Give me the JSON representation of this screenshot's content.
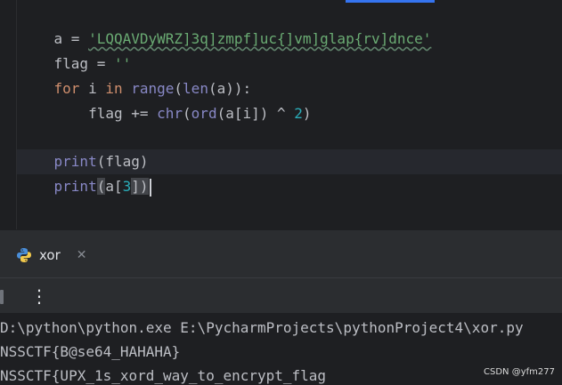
{
  "editor": {
    "lines": [
      {
        "t1": "a",
        "t2": " = ",
        "t3": "'LQQAVDyWRZ]3q]zmpf]uc{]vm]glap{rv]dnce'"
      },
      {
        "t1": "flag",
        "t2": " = ",
        "t3": "''"
      },
      {
        "k1": "for",
        "t2": " i ",
        "k2": "in",
        "b1": " range",
        "p1": "(",
        "b2": "len",
        "p2": "(a)):"
      },
      {
        "indent": "    flag += ",
        "b1": "chr",
        "p1": "(",
        "b2": "ord",
        "p2": "(a[i]) ^ ",
        "n1": "2",
        "p3": ")"
      },
      {
        "b1": "print",
        "p1": "(flag)"
      },
      {
        "b1": "print",
        "p1": "(",
        "p2": "a[",
        "n1": "3",
        "p3": "])"
      }
    ]
  },
  "tool": {
    "tab_label": "xor",
    "close_icon": "close-icon",
    "more_icon": "more-vertical-icon"
  },
  "console": {
    "lines": [
      "D:\\python\\python.exe E:\\PycharmProjects\\pythonProject4\\xor.py",
      "NSSCTF{B@se64_HAHAHA}",
      "NSSCTF{UPX_1s_xord_way_to_encrypt_flag"
    ]
  },
  "watermark": {
    "text": "CSDN @yfm277"
  },
  "colors": {
    "editor_bg": "#1e1f22",
    "panel_bg": "#2b2d30",
    "keyword": "#cf8e6d",
    "string": "#6aab73",
    "builtin": "#8888c6",
    "number": "#2aacb8",
    "text": "#bcbec4",
    "accent": "#3574f0"
  }
}
